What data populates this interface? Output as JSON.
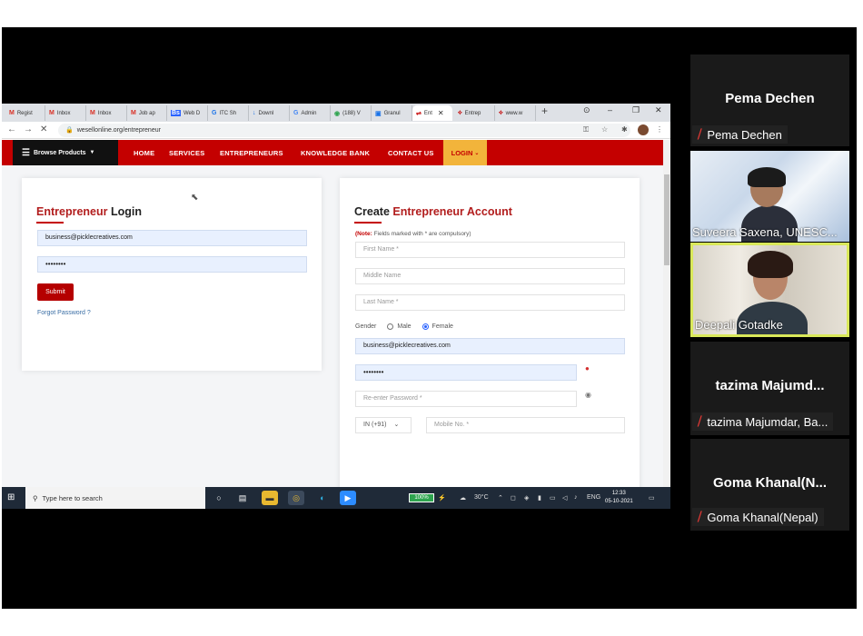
{
  "browser": {
    "tabs": [
      {
        "icon": "M",
        "label": "Regist"
      },
      {
        "icon": "M",
        "label": "Inbox"
      },
      {
        "icon": "M",
        "label": "Inbox"
      },
      {
        "icon": "M",
        "label": "Job ap"
      },
      {
        "icon": "Bs",
        "label": "Web D"
      },
      {
        "icon": "G",
        "label": "ITC Sh"
      },
      {
        "icon": "↓",
        "label": "Downl"
      },
      {
        "icon": "G",
        "label": "Admin"
      },
      {
        "icon": "◉",
        "label": "(188) V"
      },
      {
        "icon": "▣",
        "label": "Granul"
      },
      {
        "icon": "⇌",
        "label": "Ent"
      },
      {
        "icon": "⟡",
        "label": "Entrep"
      },
      {
        "icon": "⟡",
        "label": "www.w"
      }
    ],
    "url": "wesellonline.org/entrepreneur"
  },
  "site": {
    "browse_label": "Browse Products",
    "nav": [
      "HOME",
      "SERVICES",
      "ENTREPRENEURS",
      "KNOWLEDGE BANK",
      "CONTACT US"
    ],
    "login_label": "LOGIN"
  },
  "login": {
    "title_red": "Entrepreneur",
    "title_black": "Login",
    "email": "business@picklecreatives.com",
    "password": "••••••••",
    "submit": "Submit",
    "forgot": "Forgot Password ?"
  },
  "create": {
    "title_black": "Create",
    "title_red": "Entrepreneur Account",
    "note_prefix": "(Note:",
    "note_text": " Fields marked with * are compulsory)",
    "first_name": "First Name *",
    "middle_name": "Middle Name",
    "last_name": "Last Name *",
    "gender_label": "Gender",
    "male": "Male",
    "female": "Female",
    "email": "business@picklecreatives.com",
    "password": "••••••••",
    "reenter": "Re-enter Password *",
    "country_code": "IN (+91)",
    "mobile": "Mobile No. *"
  },
  "taskbar": {
    "search_placeholder": "Type here to search",
    "battery": "100%",
    "temperature": "30°C",
    "language": "ENG",
    "time": "12:33",
    "date": "05-10-2021"
  },
  "participants": {
    "p1_big": "Pema Dechen",
    "p1_label": "Pema Dechen",
    "p2_label": "Suveera Saxena, UNESC...",
    "p3_label": "Deepali Gotadke",
    "p4_big": "tazima  Majumd...",
    "p4_label": "tazima Majumdar, Ba...",
    "p5_big": "Goma Khanal(N...",
    "p5_label": "Goma Khanal(Nepal)"
  }
}
